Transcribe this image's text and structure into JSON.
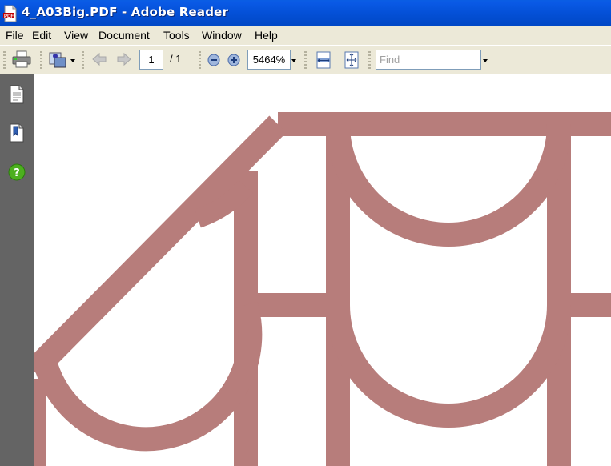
{
  "window": {
    "title": "4_A03Big.PDF - Adobe Reader"
  },
  "menu": {
    "items": [
      "File",
      "Edit",
      "View",
      "Document",
      "Tools",
      "Window",
      "Help"
    ]
  },
  "toolbar": {
    "page_current": "1",
    "page_total": "/ 1",
    "zoom": "5464%",
    "find_placeholder": "Find",
    "find_value": ""
  },
  "nav_panel": {
    "icons": [
      "pages-icon",
      "bookmarks-icon",
      "help-icon"
    ]
  },
  "document": {
    "stroke_color": "#b77d7b"
  },
  "colors": {
    "titlebar": "#0450d7",
    "panel": "#646464",
    "chrome": "#ece9d8",
    "help_green": "#4caf1e"
  }
}
